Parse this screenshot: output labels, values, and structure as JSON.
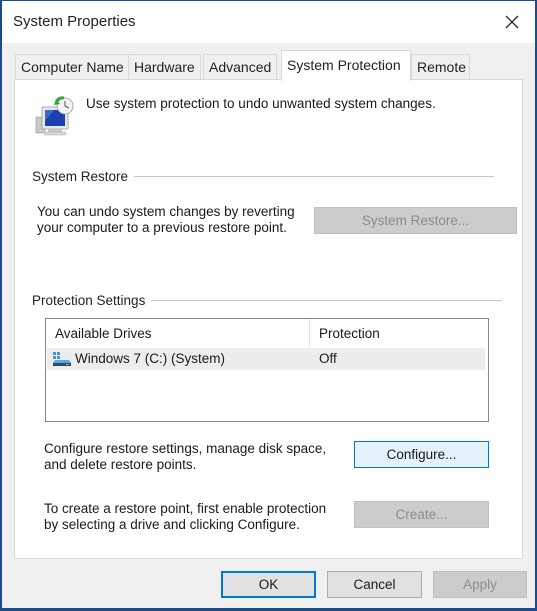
{
  "window": {
    "title": "System Properties",
    "close_icon": "close-icon"
  },
  "tabs": [
    {
      "label": "Computer Name",
      "active": false
    },
    {
      "label": "Hardware",
      "active": false
    },
    {
      "label": "Advanced",
      "active": false
    },
    {
      "label": "System Protection",
      "active": true
    },
    {
      "label": "Remote",
      "active": false
    }
  ],
  "header": {
    "icon": "system-protection-icon",
    "text": "Use system protection to undo unwanted system changes."
  },
  "system_restore": {
    "group_label": "System Restore",
    "description_line1": "You can undo system changes by reverting",
    "description_line2": "your computer to a previous restore point.",
    "button_label": "System Restore...",
    "button_enabled": false
  },
  "protection_settings": {
    "group_label": "Protection Settings",
    "columns": [
      "Available Drives",
      "Protection"
    ],
    "drives": [
      {
        "icon": "drive-icon",
        "name": "Windows 7 (C:) (System)",
        "protection": "Off",
        "selected": true
      }
    ],
    "configure_text_line1": "Configure restore settings, manage disk space,",
    "configure_text_line2": "and delete restore points.",
    "configure_button": "Configure...",
    "create_text_line1": "To create a restore point, first enable protection",
    "create_text_line2": "by selecting a drive and clicking Configure.",
    "create_button": "Create...",
    "create_enabled": false
  },
  "footer": {
    "ok": "OK",
    "cancel": "Cancel",
    "apply": "Apply",
    "apply_enabled": false
  },
  "colors": {
    "window_border": "#1c4a8a",
    "focus_accent": "#0078d7",
    "selected_row": "#ededed",
    "disabled_button": "#cccccc"
  }
}
